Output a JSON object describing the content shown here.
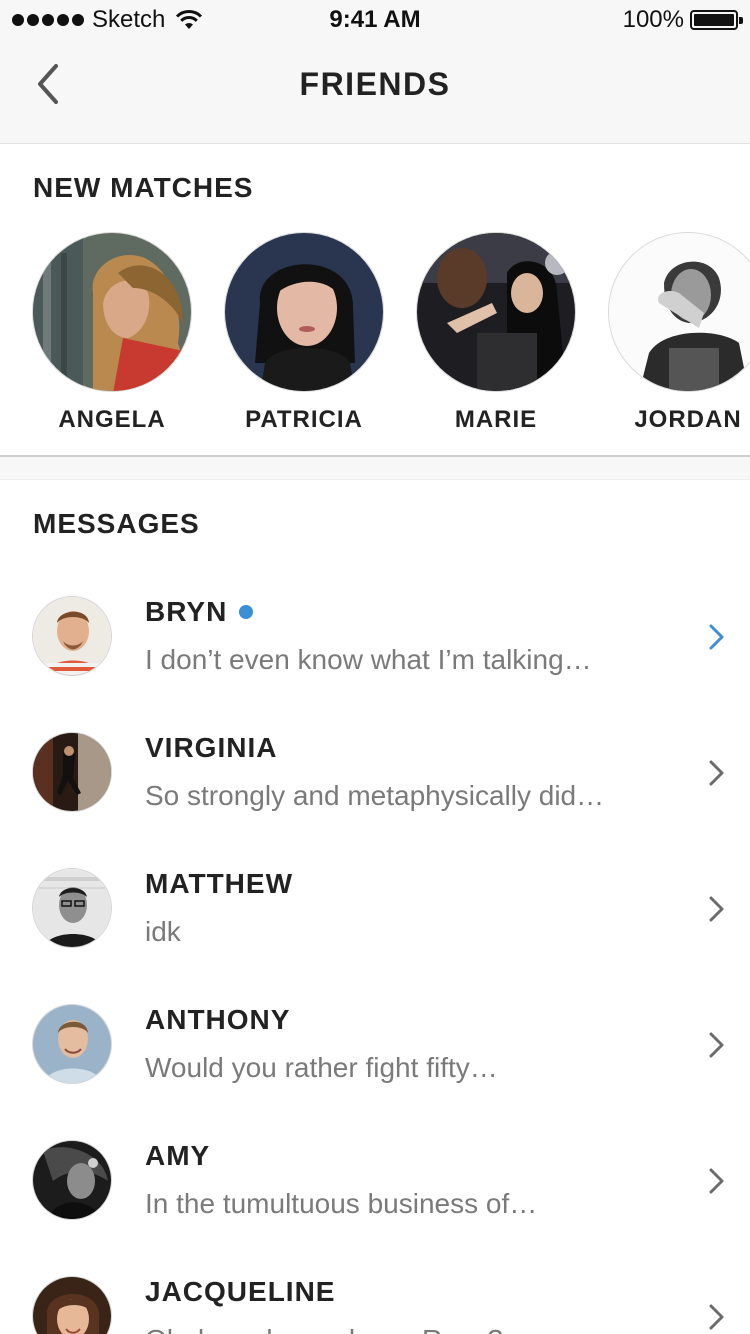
{
  "status_bar": {
    "carrier": "Sketch",
    "time": "9:41 AM",
    "battery_percent": "100%",
    "battery_level": 1.0,
    "wifi_icon": "wifi-icon",
    "battery_icon": "battery-icon"
  },
  "nav": {
    "title": "FRIENDS",
    "back_icon": "chevron-left-icon"
  },
  "new_matches": {
    "heading": "NEW MATCHES",
    "items": [
      {
        "name": "ANGELA"
      },
      {
        "name": "PATRICIA"
      },
      {
        "name": "MARIE"
      },
      {
        "name": "JORDAN"
      }
    ]
  },
  "messages": {
    "heading": "MESSAGES",
    "items": [
      {
        "name": "BRYN",
        "preview": "I don’t even know what I’m talking…",
        "online": true
      },
      {
        "name": "VIRGINIA",
        "preview": "So strongly and metaphysically did…",
        "online": false
      },
      {
        "name": "MATTHEW",
        "preview": "idk",
        "online": false
      },
      {
        "name": "ANTHONY",
        "preview": "Would you rather fight fifty…",
        "online": false
      },
      {
        "name": "AMY",
        "preview": "In the tumultuous business of…",
        "online": false
      },
      {
        "name": "JACQUELINE",
        "preview": "Oh, how do you know Ryan?",
        "online": false
      }
    ]
  },
  "colors": {
    "accent": "#3a8fd6",
    "chevron_active": "#3a8fd6",
    "chevron_default": "#6b6b6b",
    "bar_background": "#f7f7f7"
  }
}
